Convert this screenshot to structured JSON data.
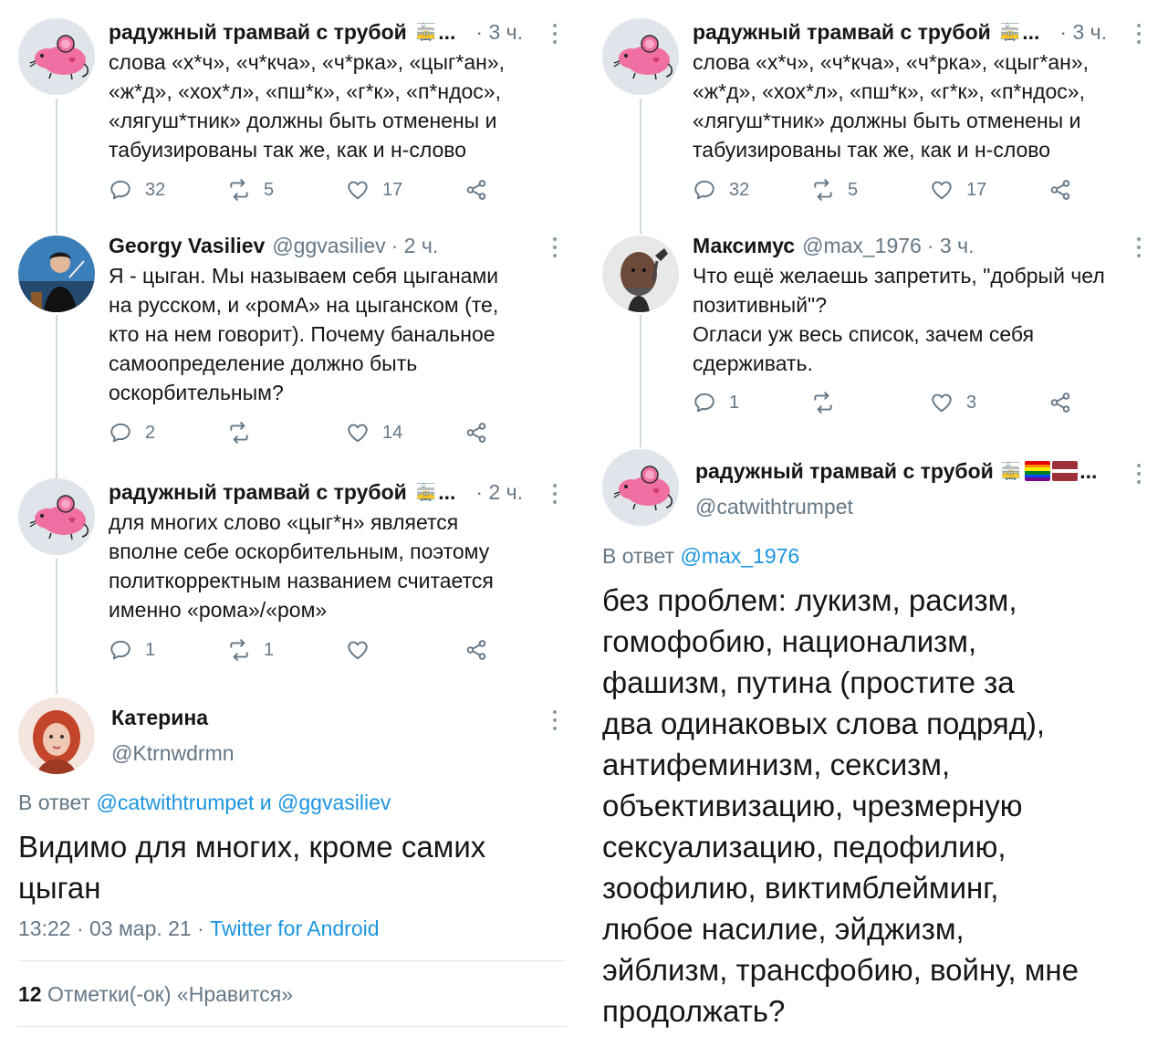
{
  "left": {
    "tweets": [
      {
        "name": "радужный трамвай с трубой",
        "tram": "🚋",
        "ellipsis": "...",
        "time": "· 3 ч.",
        "lines": [
          "слова «х*ч», «ч*кча», «ч*рка», «цыг*ан»,",
          "«ж*д», «хох*л», «пш*к», «г*к», «п*ндос»,",
          "«лягуш*тник» должны быть отменены и",
          "табуизированы так же, как и н-слово"
        ],
        "replies": "32",
        "retweets": "5",
        "likes": "17"
      },
      {
        "name": "Georgy Vasiliev",
        "handle": "@ggvasiliev",
        "time": "· 2 ч.",
        "lines": [
          "Я - цыган. Мы называем себя цыганами",
          "на русском, и «ромА» на цыганском (те,",
          "кто на нем говорит). Почему банальное",
          "самоопределение должно быть",
          "оскорбительным?"
        ],
        "replies": "2",
        "retweets": "",
        "likes": "14"
      },
      {
        "name": "радужный трамвай с трубой",
        "tram": "🚋",
        "ellipsis": "...",
        "time": "· 2 ч.",
        "lines": [
          "для многих слово «цыг*н» является",
          "вполне себе оскорбительным, поэтому",
          "политкорректным названием считается",
          "именно «рома»/«ром»"
        ],
        "replies": "1",
        "retweets": "1",
        "likes": ""
      }
    ],
    "focus": {
      "name": "Катерина",
      "handle": "@Ktrnwdrmn",
      "reply_prefix": "В ответ",
      "reply_user1": "@catwithtrumpet",
      "reply_and": "и",
      "reply_user2": "@ggvasiliev",
      "text": "Видимо для многих, кроме самих цыган",
      "meta_time": "13:22 · 03 мар. 21 ·",
      "meta_source": "Twitter for Android",
      "likes_count": "12",
      "likes_label": "Отметки(-ок) «Нравится»"
    }
  },
  "right": {
    "tweets": [
      {
        "name": "радужный трамвай с трубой",
        "tram": "🚋",
        "ellipsis": "...",
        "time": "· 3 ч.",
        "lines": [
          "слова «х*ч», «ч*кча», «ч*рка», «цыг*ан»,",
          "«ж*д», «хох*л», «пш*к», «г*к», «п*ндос»,",
          "«лягуш*тник» должны быть отменены и",
          "табуизированы так же, как и н-слово"
        ],
        "replies": "32",
        "retweets": "5",
        "likes": "17"
      },
      {
        "name": "Максимус",
        "handle": "@max_1976",
        "time": "· 3 ч.",
        "lines": [
          "Что ещё желаешь запретить, \"добрый чел",
          "позитивный\"?",
          "Огласи уж весь список, зачем себя",
          "сдерживать."
        ],
        "replies": "1",
        "retweets": "",
        "likes": "3"
      }
    ],
    "focus": {
      "name": "радужный трамвай с трубой",
      "tram": "🚋",
      "ellipsis": "...",
      "handle": "@catwithtrumpet",
      "reply_prefix": "В ответ",
      "reply_user": "@max_1976",
      "lines": [
        "без проблем: лукизм, расизм,",
        "гомофобию, национализм,",
        "фашизм, путина (простите за",
        "два одинаковых слова подряд),",
        "антифеминизм, сексизм,",
        "объективизацию, чрезмерную",
        "сексуализацию, педофилию,",
        "зоофилию, виктимблейминг,",
        "любое насилие, эйджизм,",
        "эйблизм, трансфобию, войну, мне",
        "продолжать?"
      ]
    }
  },
  "colors": {
    "link": "#1b95e0",
    "secondary_text": "#657786",
    "thread_line": "#cfd9de"
  },
  "icons": [
    "reply-icon",
    "retweet-icon",
    "like-icon",
    "share-icon",
    "more-icon"
  ]
}
